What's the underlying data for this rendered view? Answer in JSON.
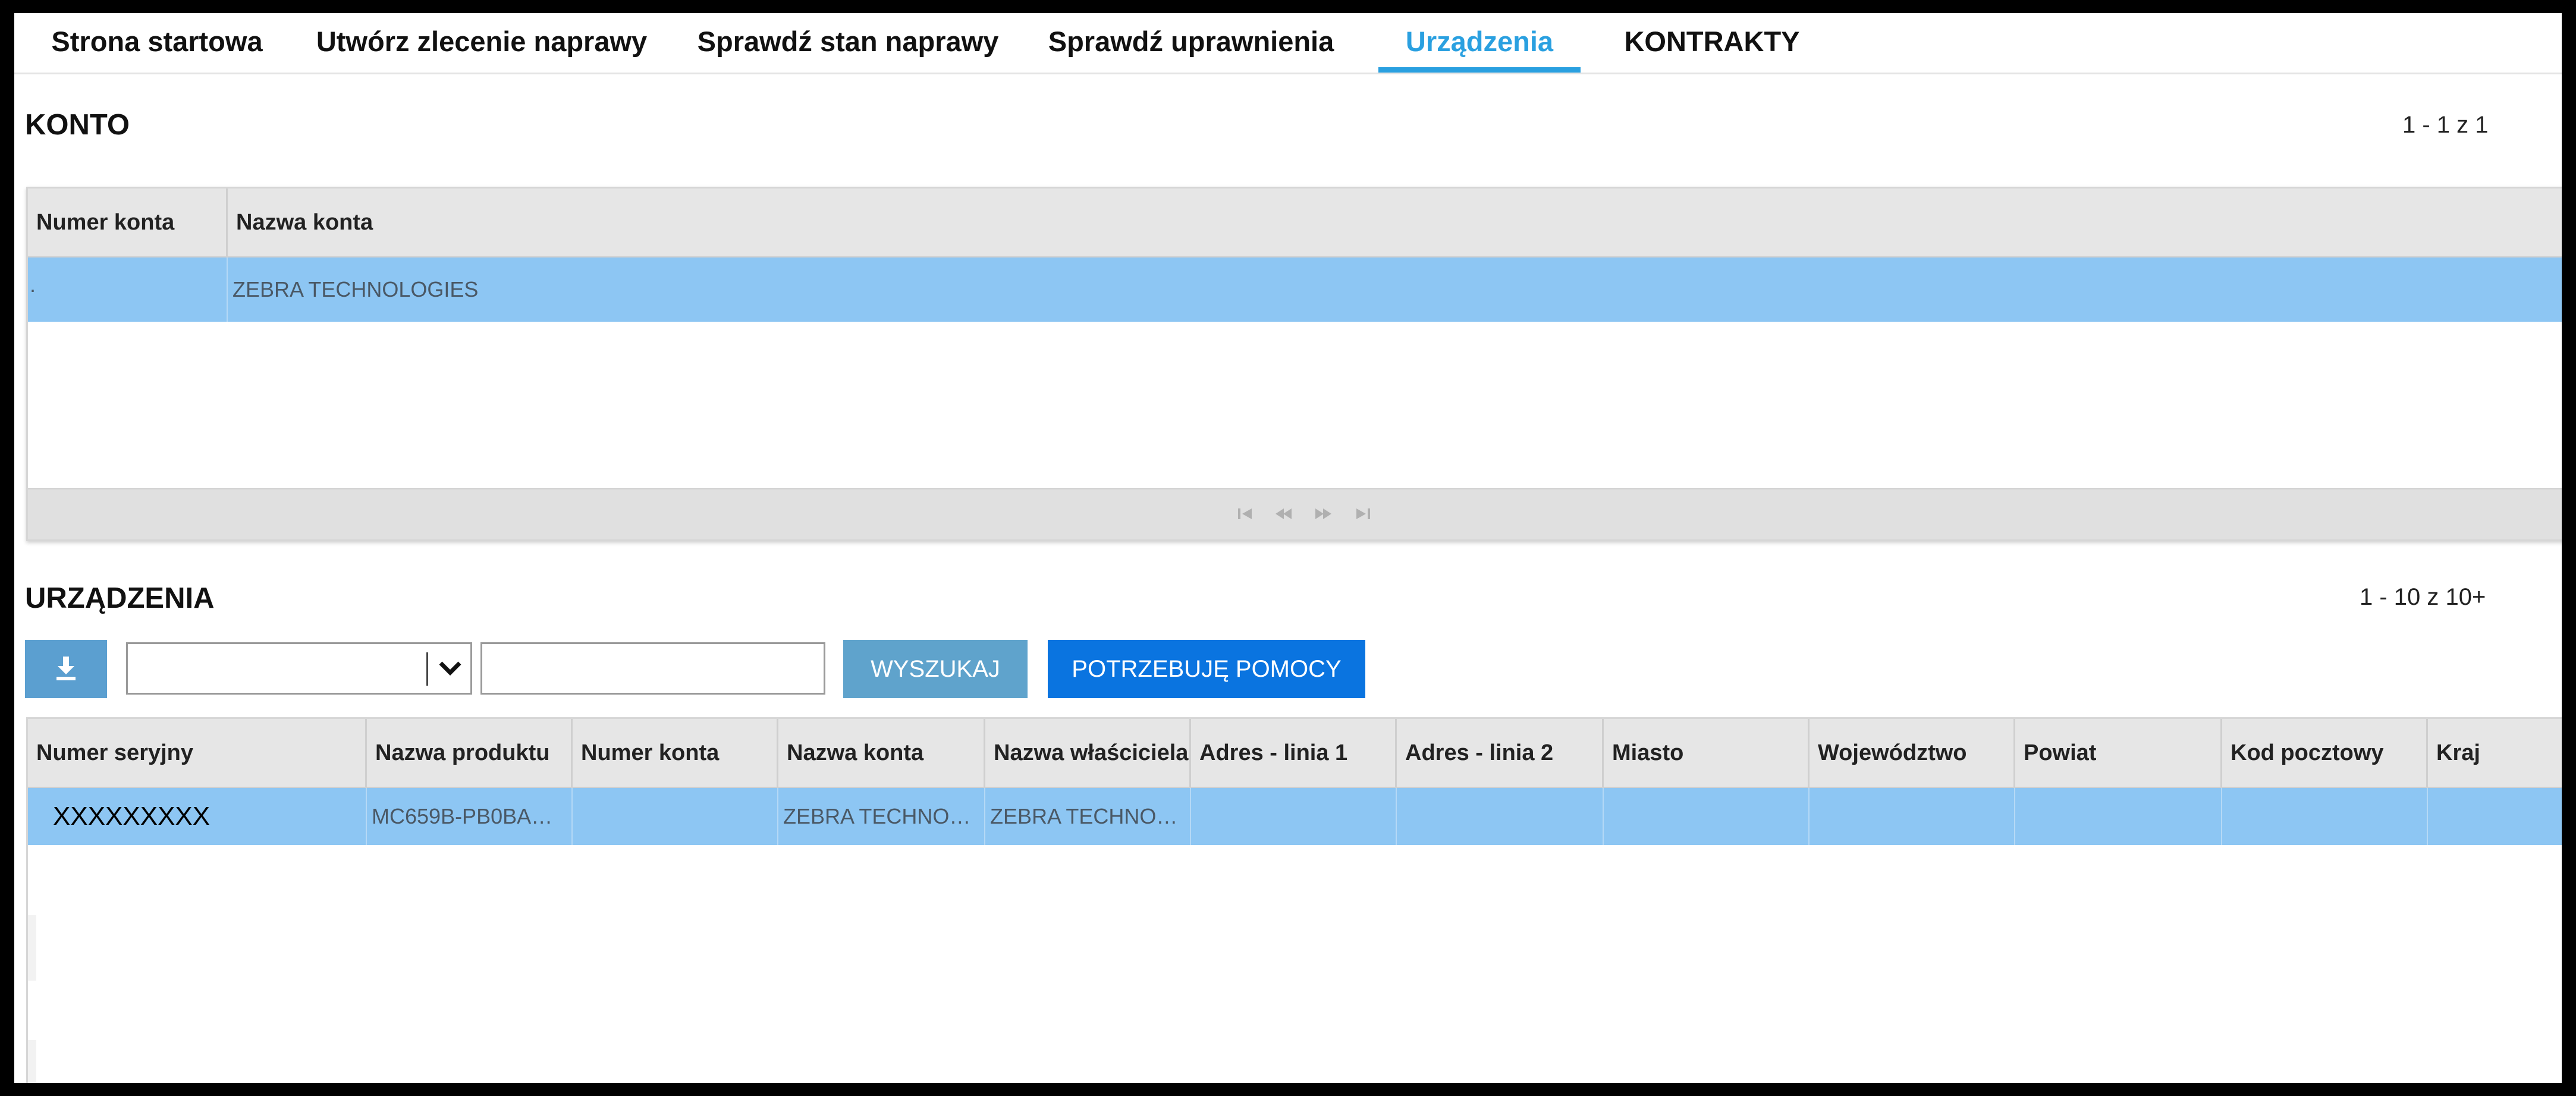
{
  "tabs": [
    {
      "label": "Strona startowa"
    },
    {
      "label": "Utwórz zlecenie naprawy"
    },
    {
      "label": "Sprawdź stan naprawy"
    },
    {
      "label": "Sprawdź uprawnienia"
    },
    {
      "label": "Urządzenia",
      "active": true
    },
    {
      "label": "KONTRAKTY"
    }
  ],
  "konto": {
    "title": "KONTO",
    "pager": "1 - 1 z 1",
    "columns": [
      "Numer konta",
      "Nazwa konta"
    ],
    "rows": [
      {
        "numer_konta": "·",
        "nazwa_konta": "ZEBRA TECHNOLOGIES"
      }
    ],
    "pager_buttons": [
      "first-page-icon",
      "prev-page-icon",
      "next-page-icon",
      "last-page-icon"
    ]
  },
  "urzadzenia": {
    "title": "URZĄDZENIA",
    "pager": "1 - 10 z 10+",
    "toolbar": {
      "export_icon": "download-icon",
      "filter_select_value": "",
      "search_value": "",
      "search_button": "WYSZUKAJ",
      "help_button": "POTRZEBUJĘ POMOCY"
    },
    "columns": [
      "Numer seryjny",
      "Nazwa produktu",
      "Numer konta",
      "Nazwa konta",
      "Nazwa właściciela",
      "Adres - linia 1",
      "Adres - linia 2",
      "Miasto",
      "Województwo",
      "Powiat",
      "Kod pocztowy",
      "Kraj"
    ],
    "rows": [
      {
        "cells": [
          "XXXXXXXXX",
          "MC659B-PB0BA…",
          "",
          "ZEBRA TECHNO…",
          "ZEBRA TECHNO…",
          "",
          "",
          "",
          "",
          "",
          "",
          ""
        ]
      }
    ]
  },
  "colors": {
    "accent_tab": "#2aa0e0",
    "selected_row": "#8dc6f3",
    "search_button": "#5fa3cc",
    "help_button": "#0a74e0",
    "export_button": "#5b9fd0"
  }
}
